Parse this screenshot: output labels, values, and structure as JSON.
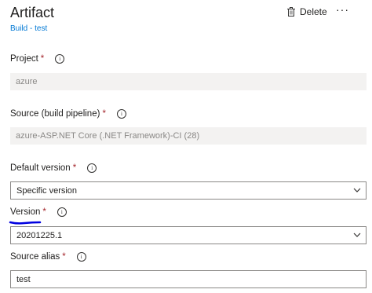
{
  "header": {
    "title": "Artifact",
    "subtitle": "Build - test",
    "delete_label": "Delete",
    "more_label": "···"
  },
  "fields": {
    "project": {
      "label": "Project",
      "required": "*",
      "value": "azure"
    },
    "source": {
      "label": "Source (build pipeline)",
      "required": "*",
      "value": "azure-ASP.NET Core (.NET Framework)-CI (28)"
    },
    "default_version": {
      "label": "Default version",
      "required": "*",
      "value": "Specific version"
    },
    "version": {
      "label": "Version",
      "required": "*",
      "value": "20201225.1"
    },
    "source_alias": {
      "label": "Source alias",
      "required": "*",
      "value": "test"
    }
  },
  "icons": {
    "info": "info-icon",
    "delete": "trash-icon",
    "chevron": "chevron-down-icon"
  },
  "colors": {
    "accent": "#0078d4",
    "required": "#a4262c",
    "annotation": "#0000e0"
  }
}
